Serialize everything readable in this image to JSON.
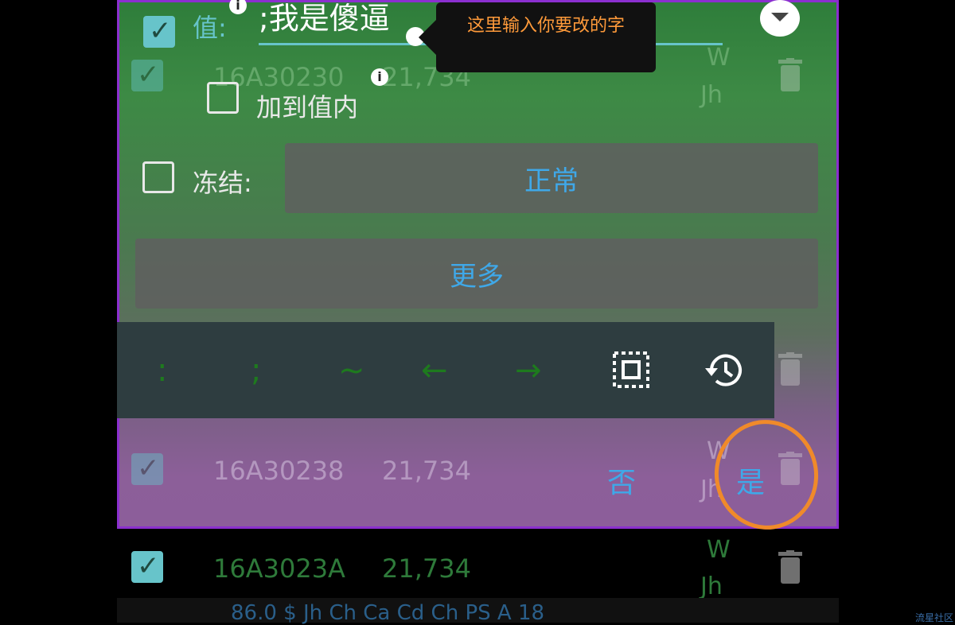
{
  "dialog": {
    "value_label": "值:",
    "value_input": ";我是傻逼",
    "add_to_value_label": "加到值内",
    "freeze_label": "冻结:",
    "freeze_mode": "正常",
    "more_label": "更多",
    "no_label": "否",
    "yes_label": "是"
  },
  "tooltip": {
    "text": "这里输入你要改的字"
  },
  "toolbar": {
    "keys": [
      ":",
      ";",
      "~",
      "←",
      "→"
    ]
  },
  "list_rows": [
    {
      "address": "16A30230",
      "value": "21,734",
      "type_1": "W",
      "type_2": "Jh"
    },
    {
      "address": "16A30238",
      "value": "21,734",
      "type_1": "W",
      "type_2": "Jh"
    },
    {
      "address": "16A3023A",
      "value": "21,734",
      "type_1": "W",
      "type_2": "Jh"
    }
  ],
  "bottom_bar": {
    "text": "86.0 $ Jh Ch Ca Cd Ch PS A 18"
  },
  "watermark": {
    "text": "流星社区"
  },
  "colors": {
    "accent": "#3fa8e8",
    "highlight": "#f08a2a",
    "panel_border": "#8b2fcf"
  }
}
